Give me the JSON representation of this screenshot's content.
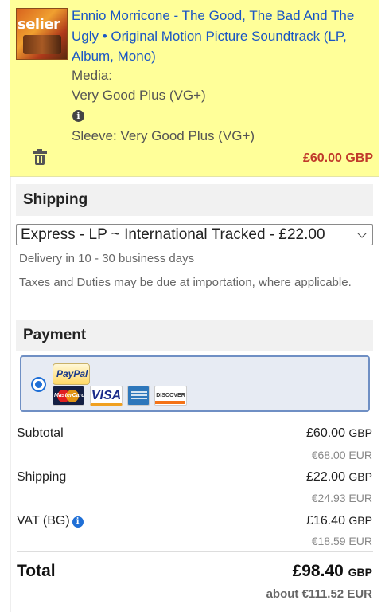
{
  "item": {
    "cover_text": "selier",
    "title": "Ennio Morricone - The Good, The Bad And The Ugly • Original Motion Picture Soundtrack (LP, Album, Mono)",
    "media_label": "Media:",
    "media_condition": "Very Good Plus (VG+)",
    "info_icon": "i",
    "sleeve": "Sleeve: Very Good Plus (VG+)",
    "price": "£60.00 GBP"
  },
  "shipping": {
    "heading": "Shipping",
    "selected_option": "Express - LP ~ International Tracked - £22.00",
    "delivery": "Delivery in 10 - 30 business days",
    "taxes_note": "Taxes and Duties may be due at importation, where applicable."
  },
  "payment": {
    "heading": "Payment",
    "paypal_label": "PayPal",
    "mastercard_label": "MasterCard",
    "visa_label": "VISA",
    "discover_label": "DISCOVER"
  },
  "summary": {
    "subtotal_label": "Subtotal",
    "subtotal_amount": "£60.00",
    "subtotal_currency": "GBP",
    "subtotal_eur": "€68.00 EUR",
    "shipping_label": "Shipping",
    "shipping_amount": "£22.00",
    "shipping_currency": "GBP",
    "shipping_eur": "€24.93 EUR",
    "vat_label": "VAT (BG)",
    "vat_info_icon": "i",
    "vat_amount": "£16.40",
    "vat_currency": "GBP",
    "vat_eur": "€18.59 EUR",
    "total_label": "Total",
    "total_amount": "£98.40",
    "total_currency": "GBP",
    "total_eur": "about €111.52 EUR"
  }
}
